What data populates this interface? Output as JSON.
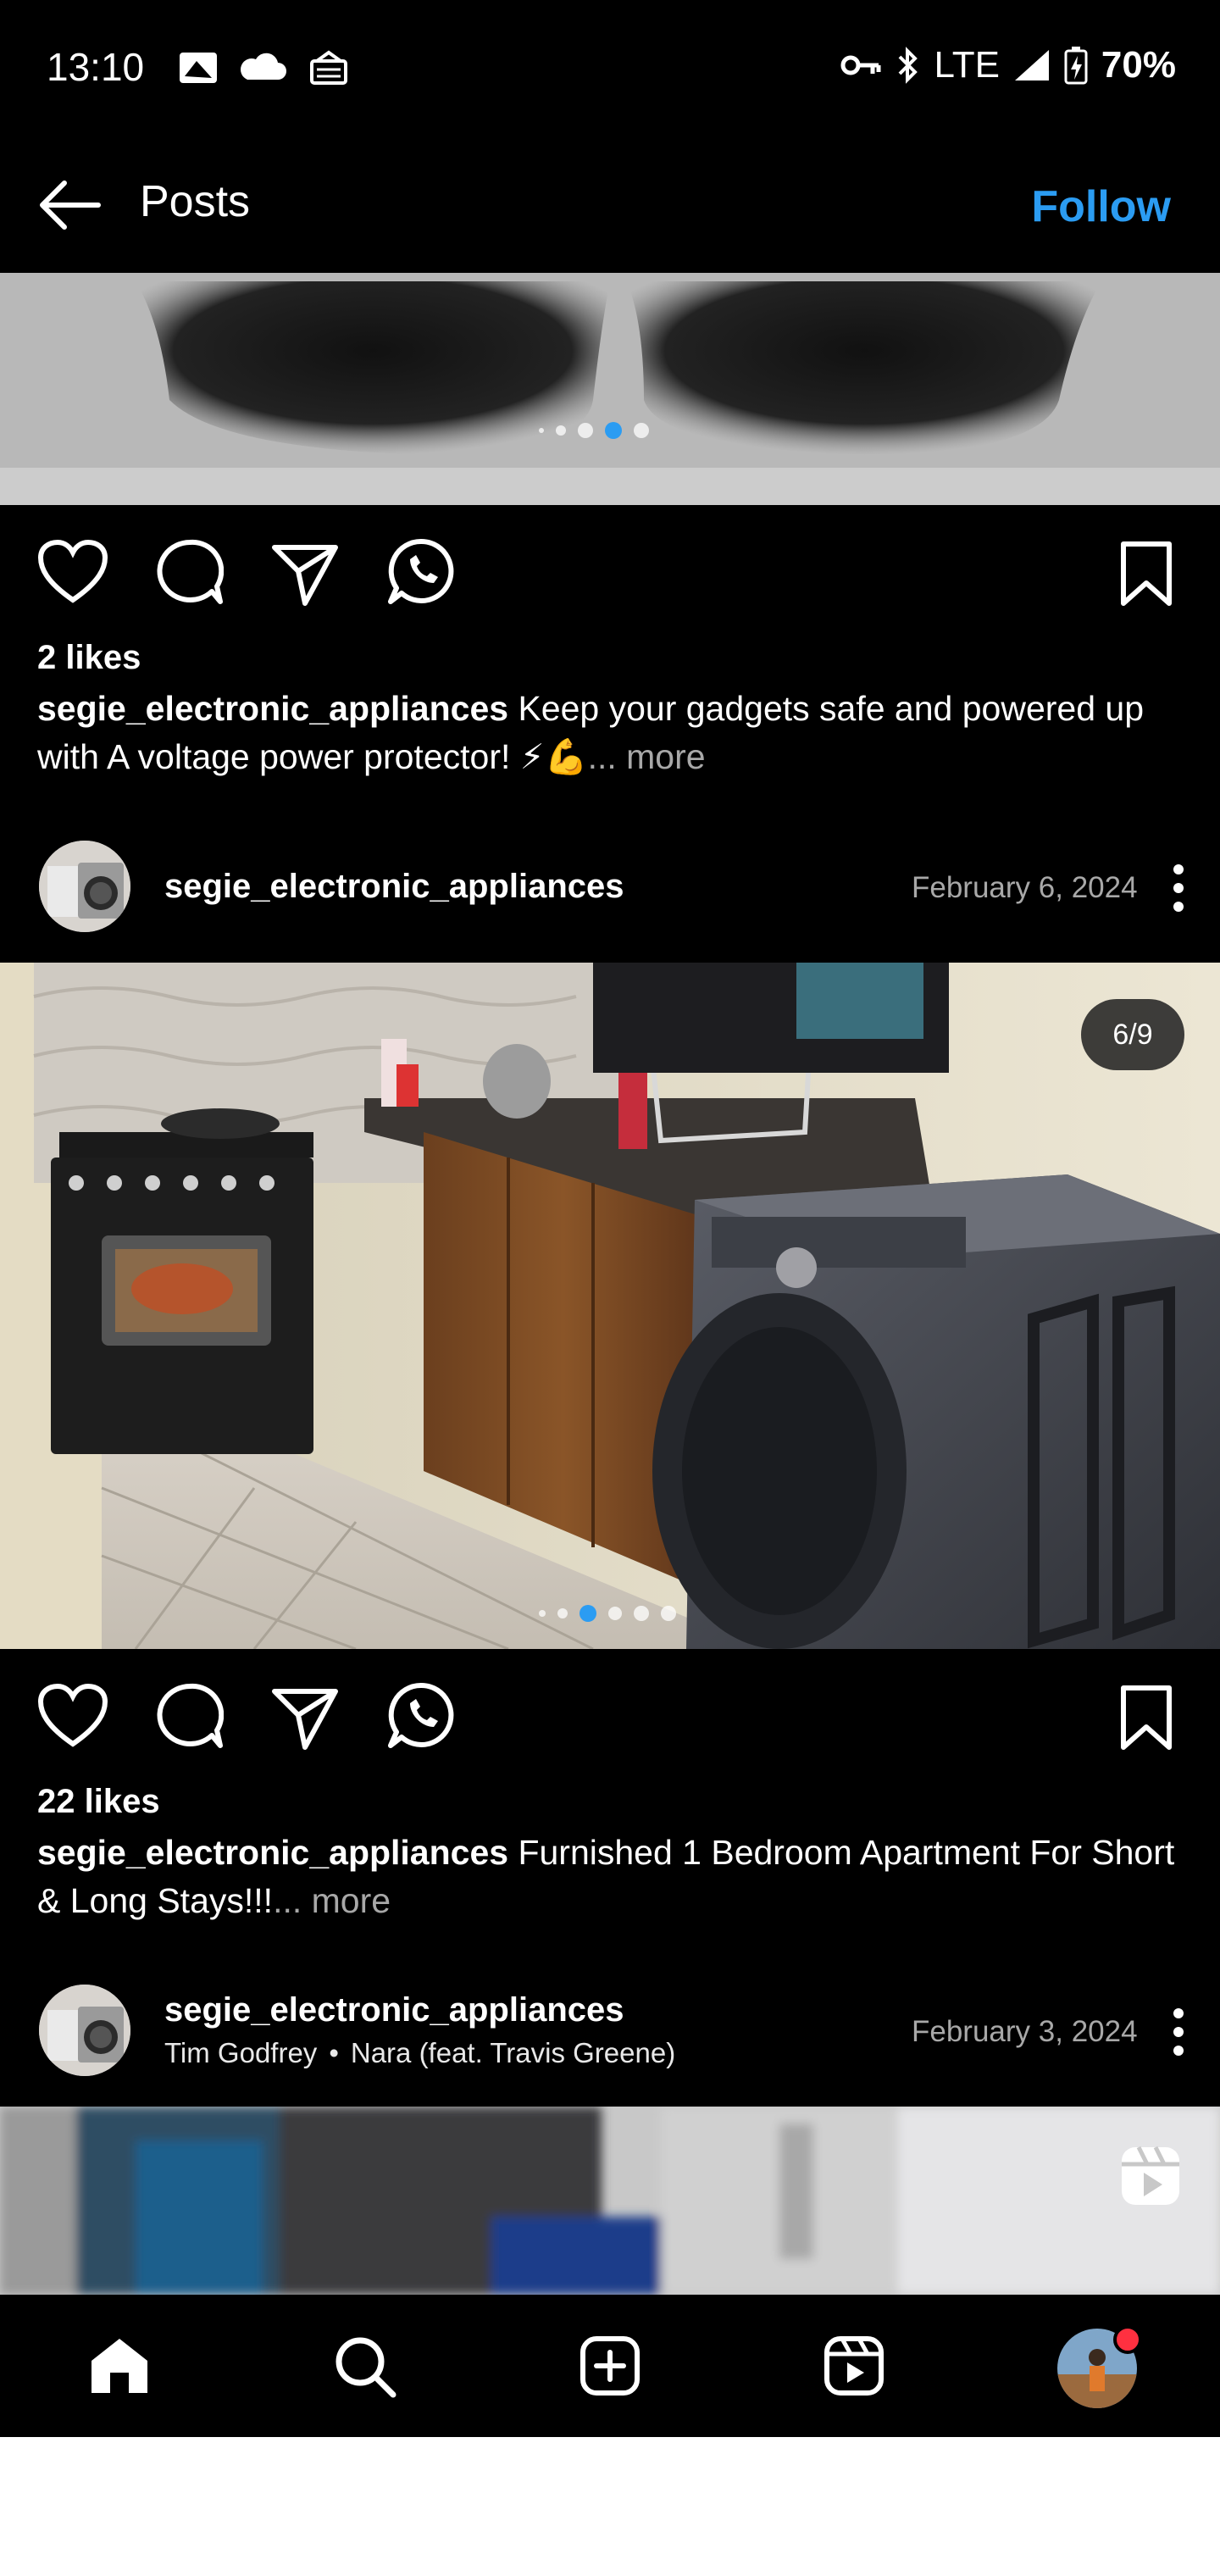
{
  "status_bar": {
    "time": "13:10",
    "network": "LTE",
    "battery": "70%"
  },
  "header": {
    "title": "Posts",
    "follow_label": "Follow"
  },
  "post1": {
    "likes": "2 likes",
    "username": "segie_electronic_appliances",
    "caption": " Keep your gadgets safe and powered up with A voltage power protector! ⚡💪",
    "more": "... more"
  },
  "post2": {
    "username": "segie_electronic_appliances",
    "date": "February 6, 2024",
    "counter": "6/9",
    "likes": "22 likes",
    "caption": " Furnished 1 Bedroom Apartment For Short & Long Stays!!!",
    "more": "... more"
  },
  "post3": {
    "username": "segie_electronic_appliances",
    "music_artist": "Tim Godfrey",
    "music_separator": "•",
    "music_title": "Nara (feat. Travis Greene)",
    "date": "February 3, 2024"
  },
  "bottom_nav": [
    "home-icon",
    "search-icon",
    "create-icon",
    "reels-icon",
    "profile-avatar"
  ],
  "colors": {
    "accent": "#2b9cf2",
    "background": "#000000",
    "notification": "#ff3040"
  }
}
